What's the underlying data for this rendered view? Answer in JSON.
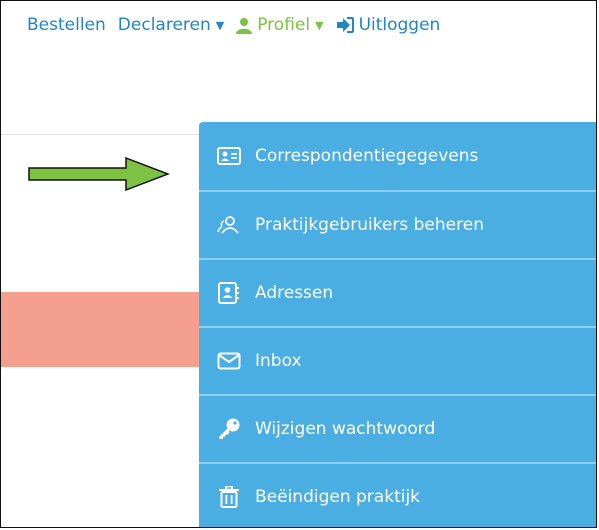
{
  "nav": {
    "bestellen": "Bestellen",
    "declareren": "Declareren",
    "profiel": "Profiel",
    "uitloggen": "Uitloggen"
  },
  "colors": {
    "link": "#1f86c7",
    "profile": "#7dc241",
    "dropdown_bg": "#4aaee3",
    "alert_bar": "#f5a08f",
    "arrow": "#7dc241"
  },
  "dropdown": {
    "items": [
      {
        "label": "Correspondentiegegevens",
        "icon": "id-card-icon"
      },
      {
        "label": "Praktijkgebruikers beheren",
        "icon": "users-icon"
      },
      {
        "label": "Adressen",
        "icon": "address-book-icon"
      },
      {
        "label": "Inbox",
        "icon": "envelope-icon"
      },
      {
        "label": "Wijzigen wachtwoord",
        "icon": "key-icon"
      },
      {
        "label": "Beëindigen praktijk",
        "icon": "trash-icon"
      }
    ]
  }
}
